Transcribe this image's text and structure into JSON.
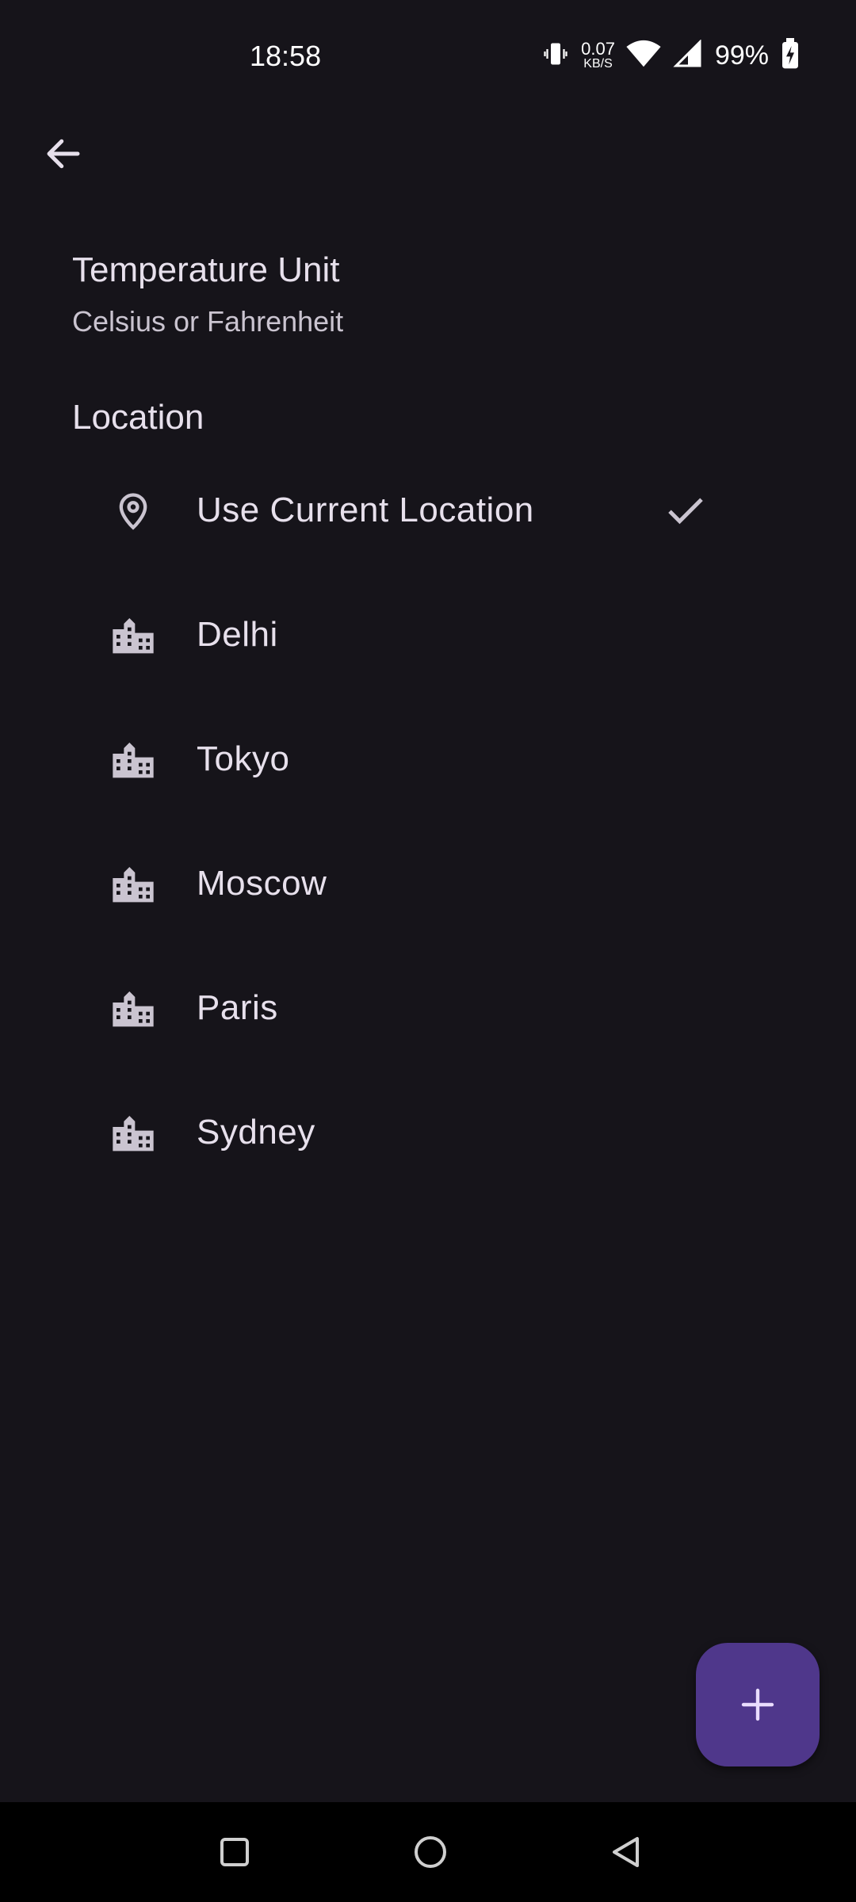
{
  "status_bar": {
    "time": "18:58",
    "net_speed_value": "0.07",
    "net_speed_unit": "KB/S",
    "battery": "99%",
    "icons": [
      "vibrate-icon",
      "wifi-icon",
      "signal-icon",
      "battery-charging-icon"
    ]
  },
  "app_bar": {
    "back_icon": "arrow-left-icon"
  },
  "settings": {
    "temperature": {
      "title": "Temperature Unit",
      "subtitle": "Celsius or Fahrenheit"
    },
    "location": {
      "header": "Location",
      "items": [
        {
          "label": "Use Current Location",
          "icon": "location-pin-icon",
          "selected": true
        },
        {
          "label": "Delhi",
          "icon": "city-icon",
          "selected": false
        },
        {
          "label": "Tokyo",
          "icon": "city-icon",
          "selected": false
        },
        {
          "label": "Moscow",
          "icon": "city-icon",
          "selected": false
        },
        {
          "label": "Paris",
          "icon": "city-icon",
          "selected": false
        },
        {
          "label": "Sydney",
          "icon": "city-icon",
          "selected": false
        }
      ]
    }
  },
  "fab": {
    "icon": "plus-icon"
  },
  "nav_bar": {
    "icons": [
      "recents-icon",
      "home-icon",
      "back-triangle-icon"
    ]
  },
  "colors": {
    "background": "#16141a",
    "fab": "#4f378b",
    "text": "#e7e0ec",
    "subtext": "#cac4d0"
  }
}
